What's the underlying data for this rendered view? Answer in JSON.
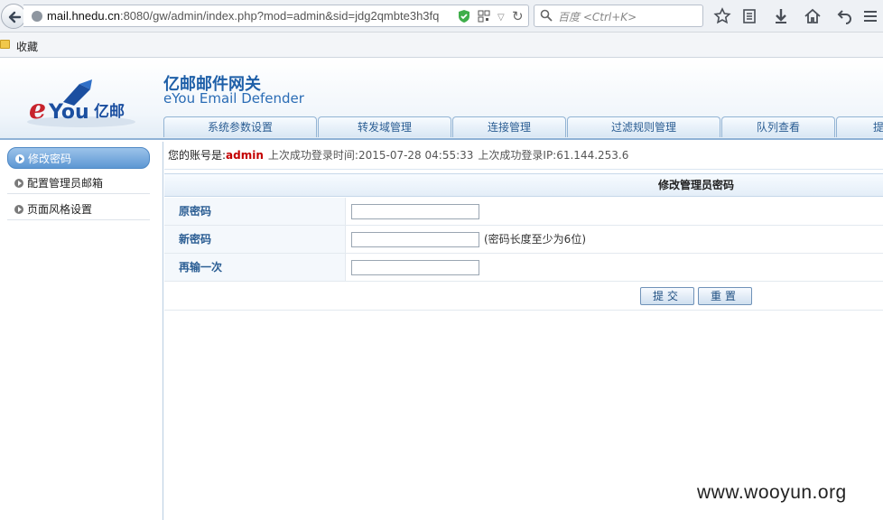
{
  "browser": {
    "url_host": "mail.hnedu.cn",
    "url_rest": ":8080/gw/admin/index.php?mod=admin&sid=jdg2qmbte3h3fq",
    "search_placeholder": "百度 <Ctrl+K>",
    "bookmarks_folder": "收藏"
  },
  "header": {
    "brand_cn": "亿邮邮件网关",
    "brand_en": "eYou Email Defender",
    "logo_text": "eYou亿邮",
    "nav_tabs": [
      "系统参数设置",
      "转发域管理",
      "连接管理",
      "过滤规则管理",
      "队列查看",
      "提"
    ]
  },
  "sidebar": {
    "items": [
      {
        "label": "修改密码",
        "active": true
      },
      {
        "label": "配置管理员邮箱",
        "active": false
      },
      {
        "label": "页面风格设置",
        "active": false
      }
    ]
  },
  "status": {
    "account_label": "您的账号是:",
    "account": "admin",
    "last_login_time": "上次成功登录时间:2015-07-28 04:55:33",
    "last_login_ip": "上次成功登录IP:61.144.253.6"
  },
  "form": {
    "title": "修改管理员密码",
    "fields": [
      {
        "label": "原密码",
        "value": "",
        "hint": ""
      },
      {
        "label": "新密码",
        "value": "",
        "hint": "(密码长度至少为6位)"
      },
      {
        "label": "再输一次",
        "value": "",
        "hint": ""
      }
    ],
    "submit_label": "提交",
    "reset_label": "重置"
  },
  "watermark": "www.wooyun.org",
  "colors": {
    "accent": "#1e5fa8",
    "account_red": "#c40000",
    "tab_text": "#2a5d93"
  }
}
